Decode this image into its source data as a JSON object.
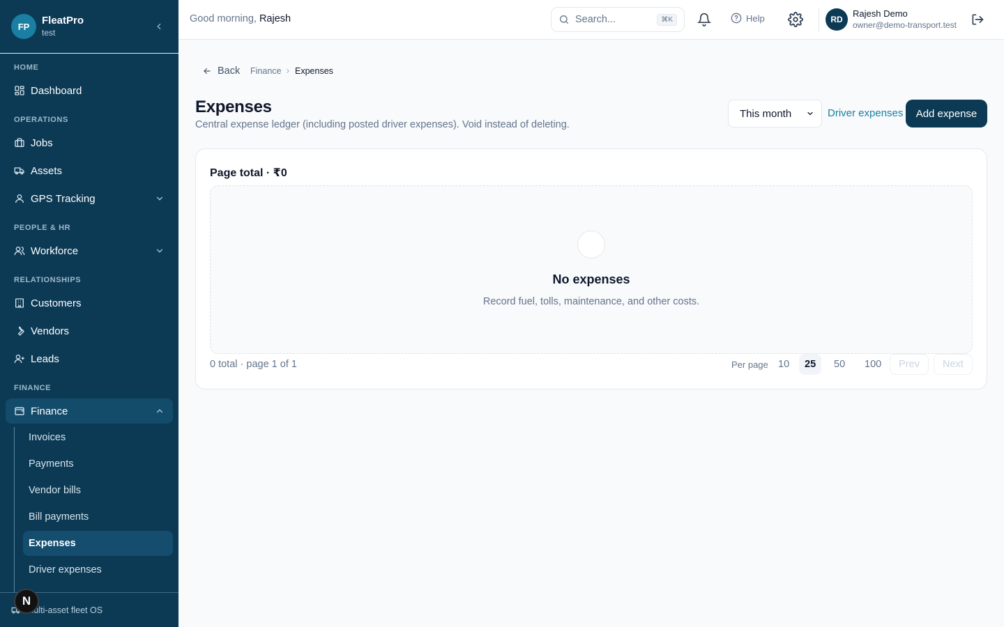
{
  "brand": {
    "initials": "FP",
    "name": "FleatPro",
    "subtitle": "test"
  },
  "nav": {
    "sections": {
      "home": "HOME",
      "operations": "OPERATIONS",
      "people": "PEOPLE & HR",
      "relationships": "RELATIONSHIPS",
      "finance": "FINANCE"
    },
    "items": {
      "dashboard": "Dashboard",
      "jobs": "Jobs",
      "assets": "Assets",
      "gps": "GPS Tracking",
      "workforce": "Workforce",
      "customers": "Customers",
      "vendors": "Vendors",
      "leads": "Leads",
      "finance": "Finance"
    },
    "finance_sub": [
      "Invoices",
      "Payments",
      "Vendor bills",
      "Bill payments",
      "Expenses",
      "Driver expenses"
    ],
    "active_sub": "Expenses"
  },
  "footer": {
    "text": "Multi-asset fleet OS",
    "badge": "N"
  },
  "topbar": {
    "greeting_prefix": "Good morning,",
    "greeting_name": "Rajesh",
    "search_placeholder": "Search...",
    "search_shortcut": "⌘K",
    "help_label": "Help",
    "user_initials": "RD",
    "user_name": "Rajesh Demo",
    "user_email": "owner@demo-transport.test"
  },
  "page": {
    "back_label": "Back",
    "breadcrumb": [
      "Finance",
      "Expenses"
    ],
    "title": "Expenses",
    "description": "Central expense ledger (including posted driver expenses). Void instead of deleting.",
    "period": "This month",
    "driver_expenses_link": "Driver expenses",
    "add_button": "Add expense"
  },
  "card": {
    "page_total": "Page total · ₹0",
    "empty_title": "No expenses",
    "empty_subtitle": "Record fuel, tolls, maintenance, and other costs.",
    "total_info": "0 total · page 1 of 1",
    "per_page_label": "Per page",
    "per_page_options": [
      "10",
      "25",
      "50",
      "100"
    ],
    "per_page_selected": "25",
    "prev_label": "Prev",
    "next_label": "Next"
  },
  "colors": {
    "sidebar": "#0c3a55",
    "accent": "#1a7fa3",
    "primary_button": "#0c3a55"
  }
}
